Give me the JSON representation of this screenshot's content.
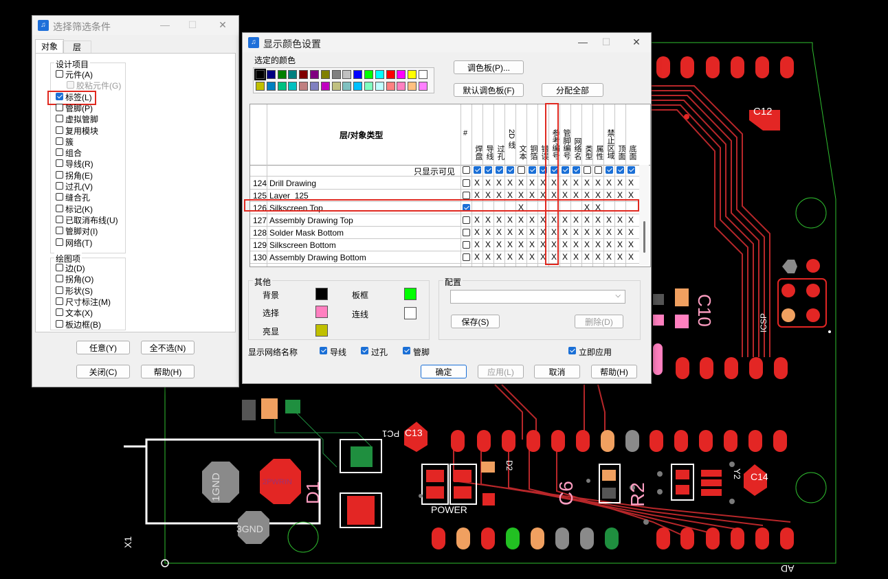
{
  "filter_dialog": {
    "title": "选择筛选条件",
    "tabs": [
      "对象",
      "层"
    ],
    "design_group_title": "设计项目",
    "design_items": [
      {
        "label": "元件(A)",
        "checked": false
      },
      {
        "label": "胶粘元件(G)",
        "checked": false,
        "disabled": true
      },
      {
        "label": "标签(L)",
        "checked": true
      },
      {
        "label": "管脚(P)",
        "checked": false
      },
      {
        "label": "虚拟管脚",
        "checked": false
      },
      {
        "label": "复用模块",
        "checked": false
      },
      {
        "label": "簇",
        "checked": false
      },
      {
        "label": "组合",
        "checked": false
      },
      {
        "label": "导线(R)",
        "checked": false
      },
      {
        "label": "拐角(E)",
        "checked": false
      },
      {
        "label": "过孔(V)",
        "checked": false
      },
      {
        "label": "缝合孔",
        "checked": false
      },
      {
        "label": "标记(K)",
        "checked": false
      },
      {
        "label": "已取消布线(U)",
        "checked": false
      },
      {
        "label": "管脚对(I)",
        "checked": false
      },
      {
        "label": "网络(T)",
        "checked": false
      }
    ],
    "drawing_group_title": "绘图项",
    "drawing_items": [
      {
        "label": "边(D)",
        "checked": false
      },
      {
        "label": "拐角(O)",
        "checked": false
      },
      {
        "label": "形状(S)",
        "checked": false
      },
      {
        "label": "尺寸标注(M)",
        "checked": false
      },
      {
        "label": "文本(X)",
        "checked": false
      },
      {
        "label": "板边框(B)",
        "checked": false
      }
    ],
    "buttons": {
      "any": "任意(Y)",
      "none": "全不选(N)",
      "close": "关闭(C)",
      "help": "帮助(H)"
    }
  },
  "color_dialog": {
    "title": "显示颜色设置",
    "selected_color_label": "选定的颜色",
    "palette_row1": [
      "#000000",
      "#000080",
      "#008000",
      "#008080",
      "#800000",
      "#800080",
      "#808000",
      "#808080",
      "#c0c0c0",
      "#0000ff",
      "#00ff00",
      "#00ffff",
      "#ff0000",
      "#ff00ff",
      "#ffff00",
      "#ffffff"
    ],
    "palette_row2": [
      "#c0c000",
      "#0080c0",
      "#00c080",
      "#00c0c0",
      "#c08080",
      "#8080c0",
      "#c000c0",
      "#c0c080",
      "#80c0c0",
      "#00c0ff",
      "#80ffc0",
      "#c0ffff",
      "#ff8080",
      "#ff80c0",
      "#ffc080",
      "#ff80ff"
    ],
    "btn_palette": "调色板(P)...",
    "btn_default_palette": "默认调色板(F)",
    "btn_assign_all": "分配全部",
    "table_header": "层/对象类型",
    "hash_col": "#",
    "columns": [
      "焊盘",
      "导线",
      "过孔",
      "2D 线",
      "文本",
      "铜箔",
      "错误",
      "参考编号",
      "管脚编号",
      "网络名",
      "类型",
      "属性",
      "禁止区域",
      "顶面",
      "底面"
    ],
    "visible_only_label": "只显示可见",
    "visible_row_checks": [
      true,
      true,
      true,
      true,
      false,
      true,
      true,
      true,
      true,
      true,
      false,
      false,
      true,
      true,
      true
    ],
    "rows": [
      {
        "num": "124",
        "name": "Drill Drawing",
        "marks": [
          "X",
          "X",
          "X",
          "X",
          "X",
          "X",
          "X",
          "X",
          "X",
          "X",
          "X",
          "X",
          "X",
          "X",
          "X"
        ]
      },
      {
        "num": "125",
        "name": "Layer_125",
        "marks": [
          "X",
          "X",
          "X",
          "X",
          "X",
          "X",
          "X",
          "X",
          "X",
          "X",
          "X",
          "X",
          "X",
          "X",
          "X"
        ]
      },
      {
        "num": "126",
        "name": "Silkscreen Top",
        "marks": [
          "",
          "",
          "",
          "",
          "X",
          "",
          "",
          "",
          "",
          "",
          "X",
          "X",
          "",
          "",
          ""
        ],
        "checked": true
      },
      {
        "num": "127",
        "name": "Assembly Drawing Top",
        "marks": [
          "X",
          "X",
          "X",
          "X",
          "X",
          "X",
          "X",
          "X",
          "X",
          "X",
          "X",
          "X",
          "X",
          "X",
          "X"
        ]
      },
      {
        "num": "128",
        "name": "Solder Mask Bottom",
        "marks": [
          "X",
          "X",
          "X",
          "X",
          "X",
          "X",
          "X",
          "X",
          "X",
          "X",
          "X",
          "X",
          "X",
          "X",
          "X"
        ]
      },
      {
        "num": "129",
        "name": "Silkscreen Bottom",
        "marks": [
          "X",
          "X",
          "X",
          "X",
          "X",
          "X",
          "X",
          "X",
          "X",
          "X",
          "X",
          "X",
          "X",
          "X",
          "X"
        ]
      },
      {
        "num": "130",
        "name": "Assembly Drawing Bottom",
        "marks": [
          "X",
          "X",
          "X",
          "X",
          "X",
          "X",
          "X",
          "X",
          "X",
          "X",
          "X",
          "X",
          "X",
          "X",
          "X"
        ]
      }
    ],
    "other_group_title": "其他",
    "other_items": {
      "background": "背景",
      "select": "选择",
      "highlight": "亮显",
      "board_frame": "板框",
      "connection": "连线"
    },
    "other_colors": {
      "background": "#000000",
      "select": "#ff80c0",
      "highlight": "#c0c000",
      "board_frame": "#00ff00",
      "connection": "#ffffff"
    },
    "config_group_title": "配置",
    "config_value": "",
    "btn_save": "保存(S)",
    "btn_delete": "删除(D)",
    "net_name_label": "显示网络名称",
    "net_checks": [
      {
        "label": "导线",
        "checked": true
      },
      {
        "label": "过孔",
        "checked": true
      },
      {
        "label": "管脚",
        "checked": true
      }
    ],
    "apply_now_label": "立即应用",
    "apply_now_checked": true,
    "btn_ok": "确定",
    "btn_apply": "应用(L)",
    "btn_cancel": "取消",
    "btn_help": "帮助(H)"
  },
  "pcb": {
    "labels": {
      "c12": "C12",
      "c10": "C10",
      "c13": "C13",
      "c14": "C14",
      "c6": "C6",
      "r2": "R2",
      "d1": "D1",
      "x1": "X1",
      "pc1": "PC1",
      "power": "POWER",
      "icsp": "ICSP",
      "ad": "AD",
      "y2": "Y2",
      "d2": "D2",
      "gnd1": "1GND",
      "pwrin": "2PWRIN",
      "gnd3": "3GND"
    }
  }
}
